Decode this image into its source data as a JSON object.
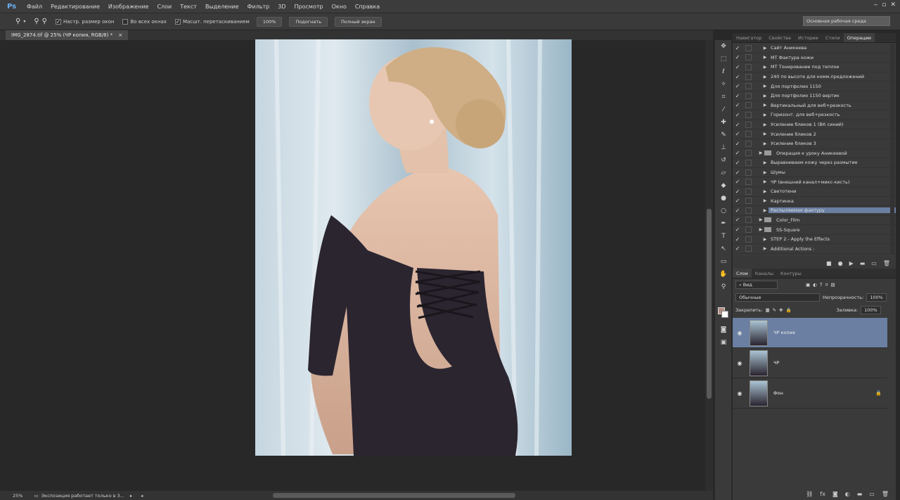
{
  "menubar": {
    "logo": "Ps",
    "items": [
      "Файл",
      "Редактирование",
      "Изображение",
      "Слои",
      "Текст",
      "Выделение",
      "Фильтр",
      "3D",
      "Просмотр",
      "Окно",
      "Справка"
    ],
    "window_buttons": [
      "‒",
      "▫",
      "✕"
    ]
  },
  "options": {
    "tool_icon": "zoom-icon",
    "check1": "Настр. размер окон",
    "check2": "Во всех окнах",
    "check3": "Масшт. перетаскиванием",
    "btn_zoom": "100%",
    "btn_fit": "Подогнать",
    "btn_fill": "Полный экран",
    "workspace": "Основная рабочая среда"
  },
  "document": {
    "tab": "IMG_2874.tif @ 25% (ЧР копия, RGB/8) *"
  },
  "status": {
    "zoom": "25%",
    "message": "Экспозиция работает только в 3..."
  },
  "panel_tabs": [
    "Навигатор",
    "Свойства",
    "Истории",
    "Стили",
    "Операции"
  ],
  "actions": [
    {
      "label": "Сайт Аникеева",
      "type": "action"
    },
    {
      "label": "МТ Фактура кожи",
      "type": "action"
    },
    {
      "label": "МТ Тонирование под теплое",
      "type": "action"
    },
    {
      "label": "240 по высоте для комм.предложений",
      "type": "action"
    },
    {
      "label": "Для портфолио 1150",
      "type": "action"
    },
    {
      "label": "Для портфолио 1150 вертик",
      "type": "action"
    },
    {
      "label": "Вертикальный для веб+резкость",
      "type": "action"
    },
    {
      "label": "Горизонт. для веб+резкость",
      "type": "action"
    },
    {
      "label": "Усиление бликов 1 (ВК синий)",
      "type": "action"
    },
    {
      "label": "Усиление бликов 2",
      "type": "action"
    },
    {
      "label": "Усиление бликов 3",
      "type": "action"
    },
    {
      "label": "Операция к уроку Аникеевой",
      "type": "set"
    },
    {
      "label": "Выравниваем кожу через размытие",
      "type": "action"
    },
    {
      "label": "Шумы",
      "type": "action"
    },
    {
      "label": "ЧР (внешний канал+микс-кисть)",
      "type": "action"
    },
    {
      "label": "Светотени",
      "type": "action"
    },
    {
      "label": "Картинка",
      "type": "action"
    },
    {
      "label": "Распыляемая фактуру",
      "type": "action",
      "selected": true
    },
    {
      "label": "Color_Film",
      "type": "set"
    },
    {
      "label": "SS-Square",
      "type": "set"
    },
    {
      "label": "STEP 2 - Apply the Effects",
      "type": "action"
    },
    {
      "label": "Additional Actions :",
      "type": "action"
    }
  ],
  "layers_tabs": [
    "Слои",
    "Каналы",
    "Контуры"
  ],
  "layers_ctrl": {
    "filter": "Вид",
    "blend": "Обычные",
    "opacity_label": "Непрозрачность:",
    "opacity": "100%",
    "lock_label": "Закрепить:",
    "fill_label": "Заливка:",
    "fill": "100%"
  },
  "layers": [
    {
      "name": "ЧР копия",
      "active": true,
      "locked": false
    },
    {
      "name": "ЧР",
      "active": false,
      "locked": false
    },
    {
      "name": "Фон",
      "active": false,
      "locked": true
    }
  ],
  "colors": {
    "accent": "#6a7fa2",
    "panel": "#3a3a3a"
  }
}
